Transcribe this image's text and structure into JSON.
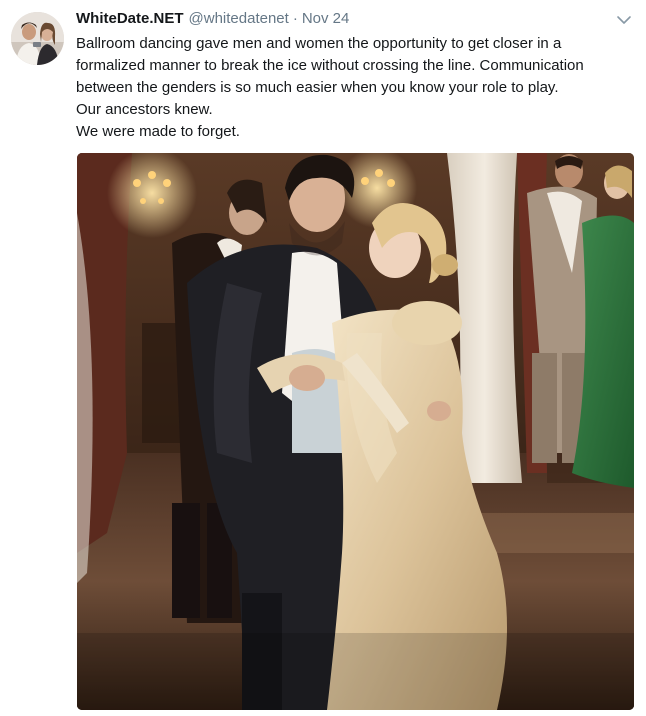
{
  "tweet": {
    "author_name": "WhiteDate.NET",
    "author_handle": "@whitedatenet",
    "separator": "·",
    "timestamp": "Nov 24",
    "text_lines": [
      "Ballroom dancing gave men and women the opportunity to get closer in a",
      "formalized manner to break the ice without crossing the line. Communication",
      "between the genders is so much easier when you know your role to play.",
      "Our ancestors knew.",
      "We were made to forget."
    ],
    "avatar_icon": "profile-avatar",
    "menu_icon": "chevron-down-icon",
    "media_icon": "ballroom-dance-photo"
  },
  "colors": {
    "text_primary": "#14171a",
    "text_secondary": "#657786",
    "background": "#ffffff"
  }
}
